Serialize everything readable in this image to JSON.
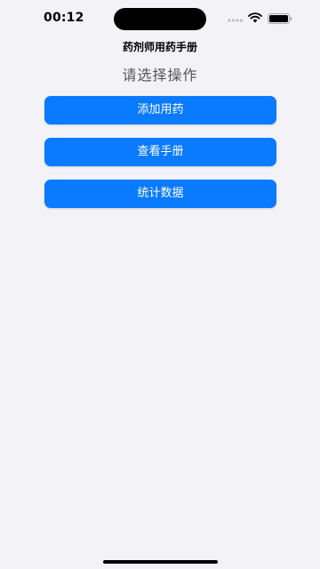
{
  "status_bar": {
    "time": "00:12"
  },
  "nav": {
    "title": "药剂师用药手册"
  },
  "main": {
    "prompt": "请选择操作",
    "buttons": [
      {
        "label": "添加用药"
      },
      {
        "label": "查看手册"
      },
      {
        "label": "统计数据"
      }
    ]
  },
  "colors": {
    "background": "#f2f2f7",
    "accent": "#0a7aff"
  },
  "icons": [
    "signal-icon",
    "wifi-icon",
    "battery-icon"
  ]
}
